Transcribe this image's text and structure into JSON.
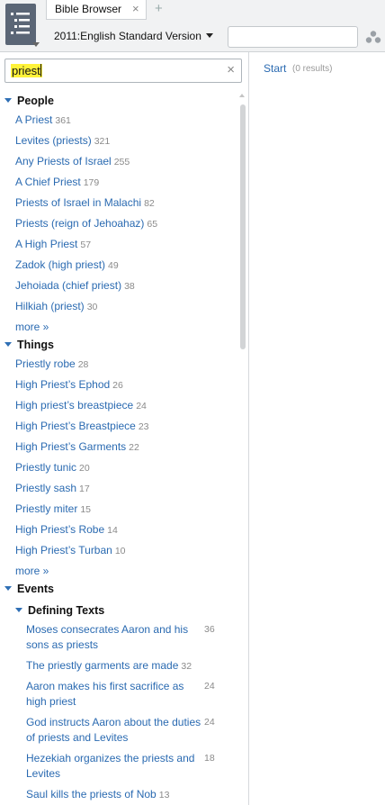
{
  "icons": {
    "app_menu": "panel-menu-icon",
    "tab_close": "close-icon",
    "new_tab": "plus-icon",
    "version_dropdown": "caret-down-icon",
    "search_clear": "close-icon",
    "cluster": "cluster-icon",
    "section_toggle": "triangle-down-icon"
  },
  "colors": {
    "link": "#2a6ab1",
    "highlight": "#fff23a",
    "toggle": "#2f6fb5",
    "app_menu_bg": "#5b6676"
  },
  "tab": {
    "title": "Bible Browser",
    "close": "×",
    "new": "+"
  },
  "toolbar": {
    "version": "2011:English Standard Version",
    "reference_value": ""
  },
  "search": {
    "value": "priest",
    "clear": "×"
  },
  "sections": {
    "people": {
      "title": "People",
      "more": "more »",
      "items": [
        {
          "label": "A Priest",
          "count": "361"
        },
        {
          "label": "Levites (priests)",
          "count": "321"
        },
        {
          "label": "Any Priests of Israel",
          "count": "255"
        },
        {
          "label": "A Chief Priest",
          "count": "179"
        },
        {
          "label": "Priests of Israel in Malachi",
          "count": "82"
        },
        {
          "label": "Priests (reign of Jehoahaz)",
          "count": "65"
        },
        {
          "label": "A High Priest",
          "count": "57"
        },
        {
          "label": "Zadok (high priest)",
          "count": "49"
        },
        {
          "label": "Jehoiada (chief priest)",
          "count": "38"
        },
        {
          "label": "Hilkiah (priest)",
          "count": "30"
        }
      ]
    },
    "things": {
      "title": "Things",
      "more": "more »",
      "items": [
        {
          "label": "Priestly robe",
          "count": "28"
        },
        {
          "label": "High Priest’s Ephod",
          "count": "26"
        },
        {
          "label": "High priest’s breastpiece",
          "count": "24"
        },
        {
          "label": "High Priest’s Breastpiece",
          "count": "23"
        },
        {
          "label": "High Priest’s Garments",
          "count": "22"
        },
        {
          "label": "Priestly tunic",
          "count": "20"
        },
        {
          "label": "Priestly sash",
          "count": "17"
        },
        {
          "label": "Priestly miter",
          "count": "15"
        },
        {
          "label": "High Priest’s Robe",
          "count": "14"
        },
        {
          "label": "High Priest’s Turban",
          "count": "10"
        }
      ]
    },
    "events": {
      "title": "Events",
      "subsection": "Defining Texts",
      "items": [
        {
          "label": "Moses consecrates Aaron and his sons as priests",
          "count": "36"
        },
        {
          "label": "The priestly garments are made",
          "count": "32"
        },
        {
          "label": "Aaron makes his first sacrifice as high priest",
          "count": "24"
        },
        {
          "label": "God instructs Aaron about the duties of priests and Levites",
          "count": "24"
        },
        {
          "label": "Hezekiah organizes the priests and Levites",
          "count": "18"
        },
        {
          "label": "Saul kills the priests of Nob",
          "count": "13"
        }
      ]
    }
  },
  "right_pane": {
    "start": "Start",
    "results": "(0 results)"
  }
}
